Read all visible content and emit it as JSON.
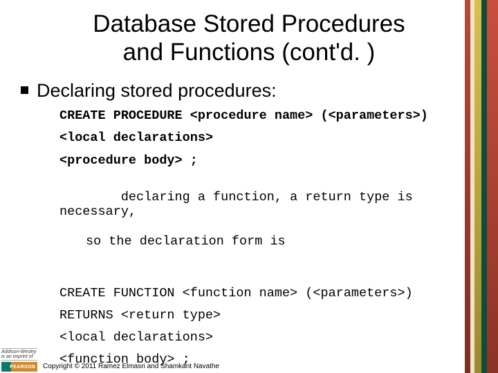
{
  "title_line1": "Database Stored Procedures",
  "title_line2": "and Functions (cont'd. )",
  "bullet": "Declaring stored procedures:",
  "code": {
    "l1": "CREATE PROCEDURE <procedure name> (<parameters>)",
    "l2": "<local declarations>",
    "l3": "<procedure body> ;",
    "l4a": "declaring a function, a return type is necessary,",
    "l4b": "so the declaration form is",
    "l5": "CREATE FUNCTION <function name> (<parameters>)",
    "l6": "RETURNS <return type>",
    "l7": "<local declarations>",
    "l8": "<function body> ;"
  },
  "publisher": {
    "imprint": "Addison-Wesley",
    "sub": "is an imprint of",
    "brand": "PEARSON"
  },
  "copyright": "Copyright © 2011 Ramez Elmasri and Shamkant Navathe"
}
